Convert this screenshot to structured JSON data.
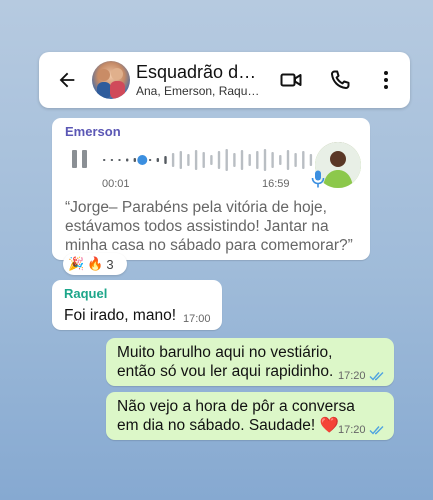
{
  "header": {
    "title": "Esquadrão do…",
    "members": "Ana, Emerson, Raqu…",
    "back_icon": "arrow-back-icon",
    "video_icon": "video-call-icon",
    "call_icon": "phone-icon",
    "menu_icon": "more-vert-icon"
  },
  "messages": {
    "voice": {
      "sender": "Emerson",
      "sender_color": "#5b57b5",
      "current": "00:01",
      "duration": "16:59",
      "progress": 0.05,
      "quote": "“Jorge– Parabéns pela vitória de hoje, estávamos todos assistindo! Jantar na minha casa no sábado para comemorar?”",
      "reactions": {
        "emojis": [
          "🎉",
          "🔥"
        ],
        "count": "3"
      }
    },
    "raquel": {
      "sender": "Raquel",
      "sender_color": "#1da68a",
      "text": "Foi irado, mano!",
      "time": "17:00"
    },
    "out1": {
      "text": "Muito barulho aqui no vestiário, então só vou ler aqui rapidinho.",
      "time": "17:20"
    },
    "out2": {
      "text": "Não vejo a hora de pôr a conversa em dia no sábado. Saudade!",
      "heart": "❤️",
      "time": "17:20"
    }
  },
  "colors": {
    "outgoing_bubble": "#dcf7c8",
    "read_ticks": "#4fa3e0"
  }
}
